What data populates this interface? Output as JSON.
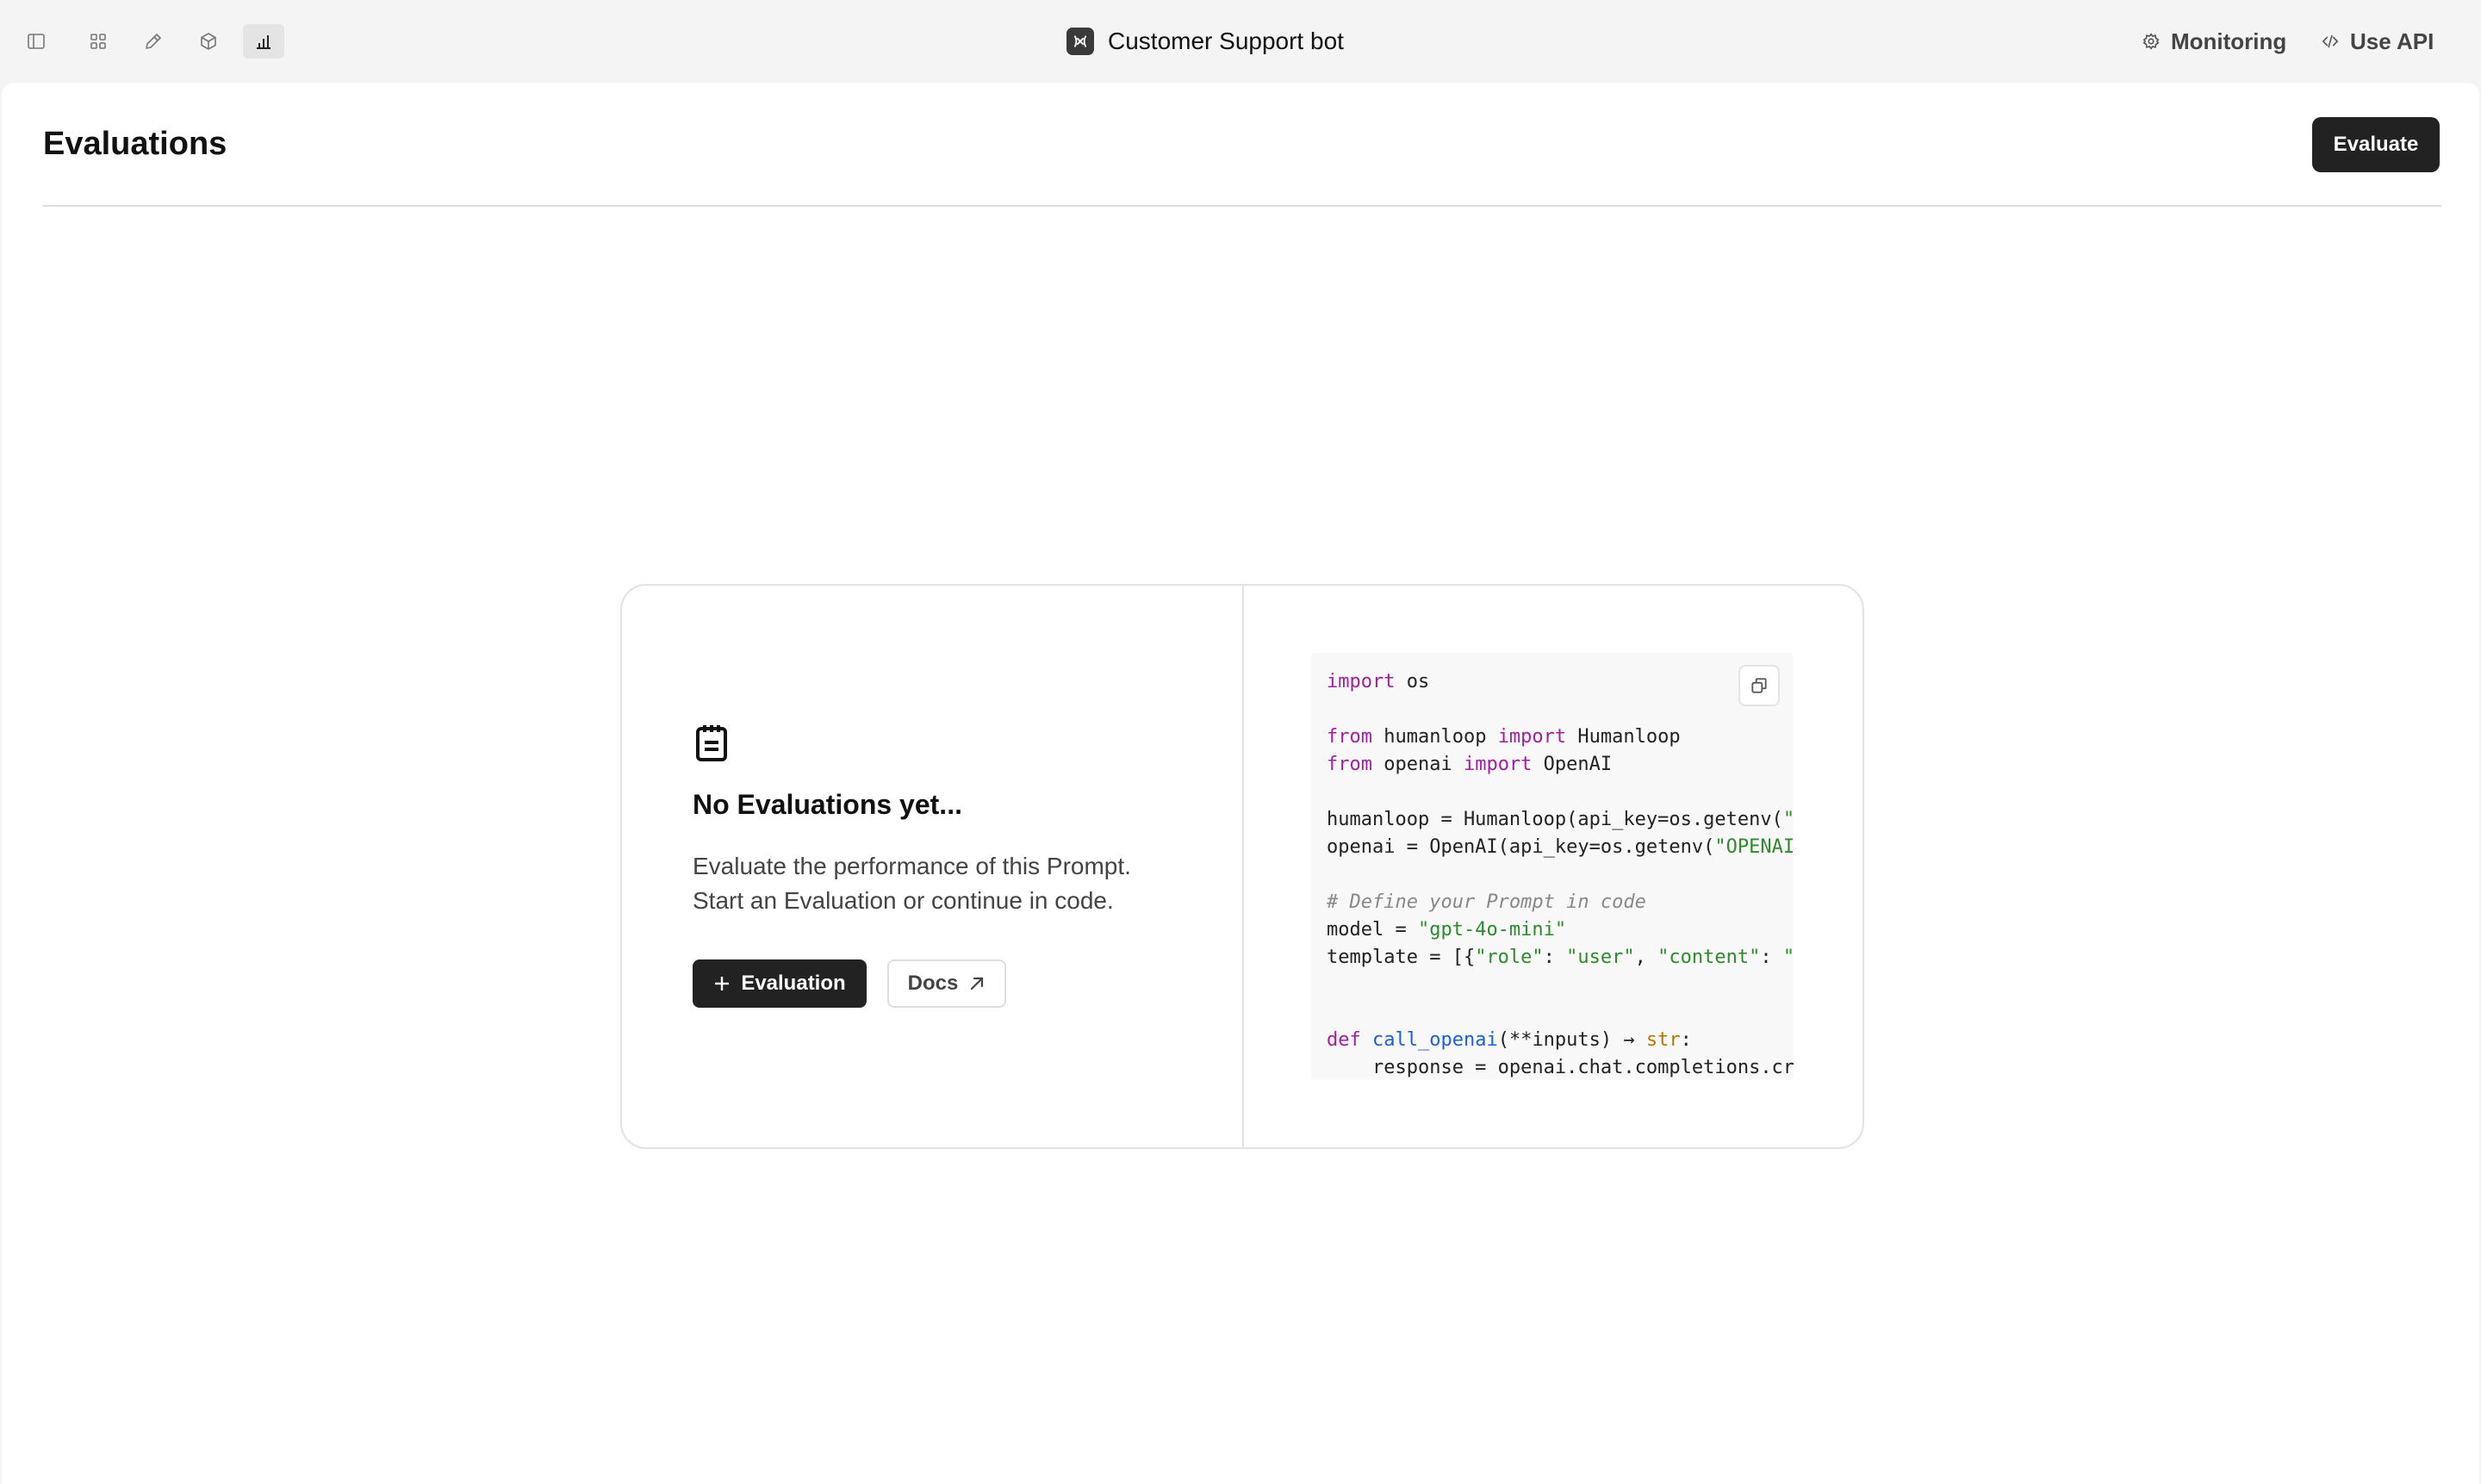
{
  "topbar": {
    "app_title": "Customer Support bot",
    "monitoring_label": "Monitoring",
    "use_api_label": "Use API"
  },
  "page": {
    "title": "Evaluations",
    "evaluate_button": "Evaluate"
  },
  "empty_state": {
    "title": "No Evaluations yet...",
    "description_line1": "Evaluate the performance of this Prompt.",
    "description_line2": "Start an Evaluation or continue in code.",
    "add_evaluation_label": "Evaluation",
    "docs_label": "Docs"
  },
  "code": {
    "l1_kw": "import",
    "l1_rest": " os",
    "l3_kw1": "from",
    "l3_mid": " humanloop ",
    "l3_kw2": "import",
    "l3_rest": " Humanloop",
    "l4_kw1": "from",
    "l4_mid": " openai ",
    "l4_kw2": "import",
    "l4_rest": " OpenAI",
    "l6_code": "humanloop = Humanloop(api_key=os.getenv(",
    "l6_str": "\"",
    "l7_code": "openai = OpenAI(api_key=os.getenv(",
    "l7_str": "\"OPENAI",
    "l9_comment": "# Define your Prompt in code",
    "l10_code": "model = ",
    "l10_str": "\"gpt-4o-mini\"",
    "l11_code1": "template = [{",
    "l11_str1": "\"role\"",
    "l11_code2": ": ",
    "l11_str2": "\"user\"",
    "l11_code3": ", ",
    "l11_str3": "\"content\"",
    "l11_code4": ": ",
    "l11_str4": "\"",
    "l14_kw": "def",
    "l14_fn": "call_openai",
    "l14_args": "(**inputs) → ",
    "l14_type": "str",
    "l14_end": ":",
    "l15_code": "    response = openai.chat.completions.cr"
  },
  "colors": {
    "accent_dark": "#222222",
    "keyword": "#a020a0",
    "string": "#2f8a2f",
    "comment": "#888888",
    "function": "#1f5fd6",
    "builtin": "#b07a00"
  },
  "icons": {
    "toolbar": [
      "sidebar-toggle-icon",
      "grid-icon",
      "pencil-icon",
      "cube-icon",
      "bar-chart-icon"
    ],
    "monitoring": "gear-icon",
    "use_api": "code-icon",
    "empty_state": "clipboard-icon",
    "add": "plus-icon",
    "docs": "arrow-up-right-icon",
    "copy": "copy-icon"
  }
}
